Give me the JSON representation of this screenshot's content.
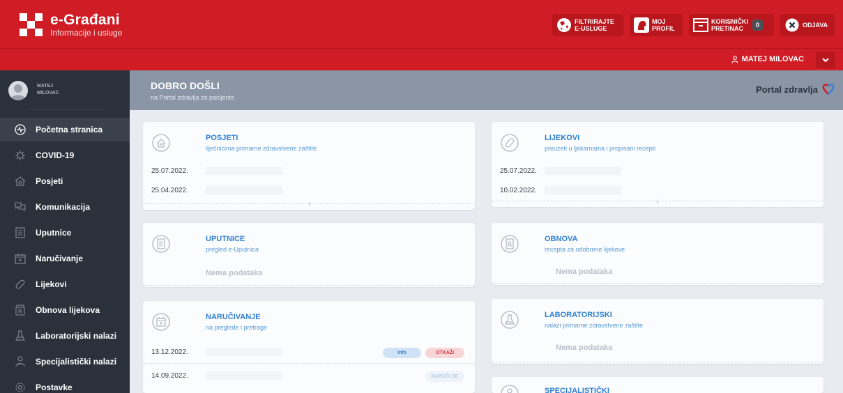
{
  "brand": {
    "title": "e-Građani",
    "subtitle": "Informacije i usluge"
  },
  "header_buttons": {
    "filter": {
      "line1": "FILTRIRAJTE",
      "line2": "E-USLUGE"
    },
    "profile": {
      "line1": "MOJ",
      "line2": "PROFIL"
    },
    "inbox": {
      "line1": "KORISNIČKI",
      "line2": "PRETINAC",
      "count": "0"
    },
    "logout": {
      "label": "ODJAVA"
    }
  },
  "user": {
    "name": "MATEJ MILOVAC",
    "sidebar_first": "MATEJ",
    "sidebar_last": "MILOVAC"
  },
  "sidebar": {
    "items": [
      {
        "label": "Početna stranica",
        "icon": "pulse-icon"
      },
      {
        "label": "COVID-19",
        "icon": "virus-icon"
      },
      {
        "label": "Posjeti",
        "icon": "home-medical-icon"
      },
      {
        "label": "Komunikacija",
        "icon": "chat-icon"
      },
      {
        "label": "Uputnice",
        "icon": "document-icon"
      },
      {
        "label": "Naručivanje",
        "icon": "calendar-icon"
      },
      {
        "label": "Lijekovi",
        "icon": "pill-icon"
      },
      {
        "label": "Obnova lijekova",
        "icon": "prescription-icon"
      },
      {
        "label": "Laboratorijski nalazi",
        "icon": "flask-icon"
      },
      {
        "label": "Specijalistički nalazi",
        "icon": "doctor-icon"
      },
      {
        "label": "Postavke",
        "icon": "gear-icon"
      }
    ]
  },
  "main": {
    "title": "DOBRO DOŠLI",
    "subtitle": "na Portal zdravlja za pacijente",
    "portal_label": "Portal zdravlja"
  },
  "cards": {
    "posjeti": {
      "title": "POSJETI",
      "subtitle": "liječnicima primarne zdravstvene zaštite",
      "rows": [
        "25.07.2022.",
        "25.04.2022."
      ]
    },
    "lijekovi": {
      "title": "LIJEKOVI",
      "subtitle": "preuzeti u ljekarnama i propisani recepti",
      "rows": [
        "25.07.2022.",
        "10.02.2022."
      ]
    },
    "uputnice": {
      "title": "UPUTNICE",
      "subtitle": "pregled e-Uputnica",
      "empty": "Nema podataka"
    },
    "obnova": {
      "title": "OBNOVA",
      "subtitle": "recepta za odobrene lijekove",
      "empty": "Nema podataka"
    },
    "narucivanje": {
      "title": "NARUČIVANJE",
      "subtitle": "na preglede i pretrage",
      "rows": [
        "13.12.2022.",
        "14.09.2022."
      ],
      "info_label": "info",
      "cancel_label": "OTKAŽI",
      "order_label": "NARUČI SE"
    },
    "laboratorijski": {
      "title": "LABORATORIJSKI",
      "subtitle": "nalazi primarne zdravstvene zaštite",
      "empty": "Nema podataka"
    },
    "specijalisticki": {
      "title": "SPECIJALISTIČKI"
    }
  },
  "colors": {
    "brand_red": "#d01c24",
    "sidebar_bg": "#2b313b",
    "accent_blue": "#2f7fd3"
  }
}
